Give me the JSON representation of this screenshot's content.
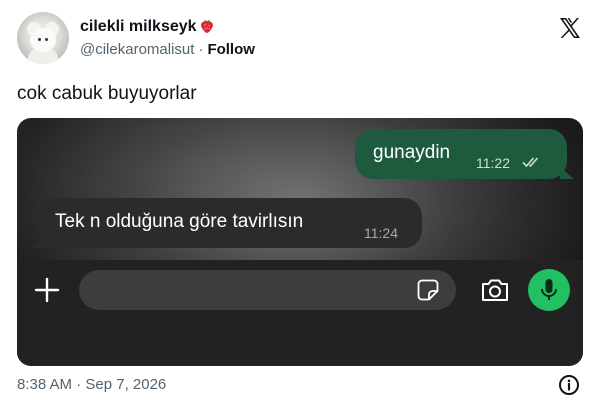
{
  "author": {
    "display_name": "cilekli milkseyk",
    "emoji_icon": "strawberry-icon",
    "handle": "@cilekaromalisut",
    "separator": "·",
    "follow_label": "Follow"
  },
  "tweet": {
    "text": "cok cabuk buyuyorlar",
    "timestamp": "8:38 AM · Sep 7, 2026"
  },
  "chat": {
    "outgoing": {
      "text": "gunaydin",
      "time": "11:22"
    },
    "incoming": {
      "text": "Tek n olduğuna göre tavirlısın",
      "time": "11:24"
    }
  },
  "colors": {
    "outgoing_bubble": "#1e5b3e",
    "incoming_bubble": "#2b2b2b",
    "mic_button": "#21c063",
    "secondary_text": "#536471"
  }
}
